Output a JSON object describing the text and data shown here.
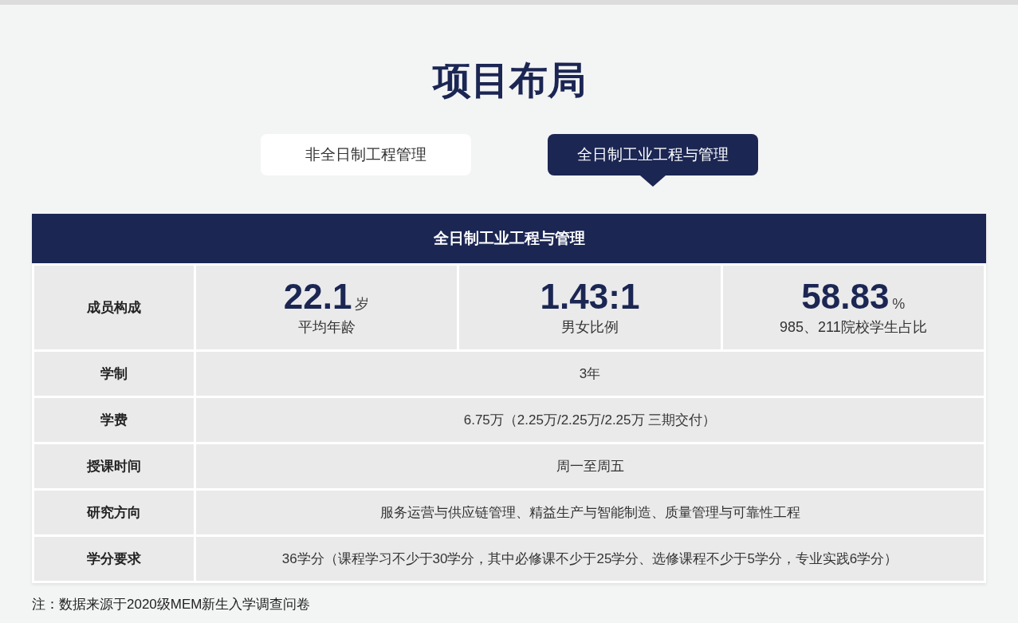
{
  "title": "项目布局",
  "tabs": [
    {
      "label": "非全日制工程管理",
      "selected": false
    },
    {
      "label": "全日制工业工程与管理",
      "selected": true
    }
  ],
  "table": {
    "heading": "全日制工业工程与管理",
    "stats_row": {
      "label": "成员构成",
      "stats": [
        {
          "value": "22.1",
          "unit": "岁",
          "caption": "平均年龄"
        },
        {
          "value": "1.43:1",
          "caption": "男女比例"
        },
        {
          "value": "58.83",
          "unit": "%",
          "caption": "985、211院校学生占比"
        }
      ]
    },
    "rows": [
      {
        "label": "学制",
        "value": "3年"
      },
      {
        "label": "学费",
        "value": "6.75万（2.25万/2.25万/2.25万 三期交付）"
      },
      {
        "label": "授课时间",
        "value": "周一至周五"
      },
      {
        "label": "研究方向",
        "value": "服务运营与供应链管理、精益生产与智能制造、质量管理与可靠性工程"
      },
      {
        "label": "学分要求",
        "value": "36学分（课程学习不少于30学分，其中必修课不少于25学分、选修课程不少于5学分，专业实践6学分）"
      }
    ]
  },
  "note": "注：数据来源于2020级MEM新生入学调查问卷"
}
